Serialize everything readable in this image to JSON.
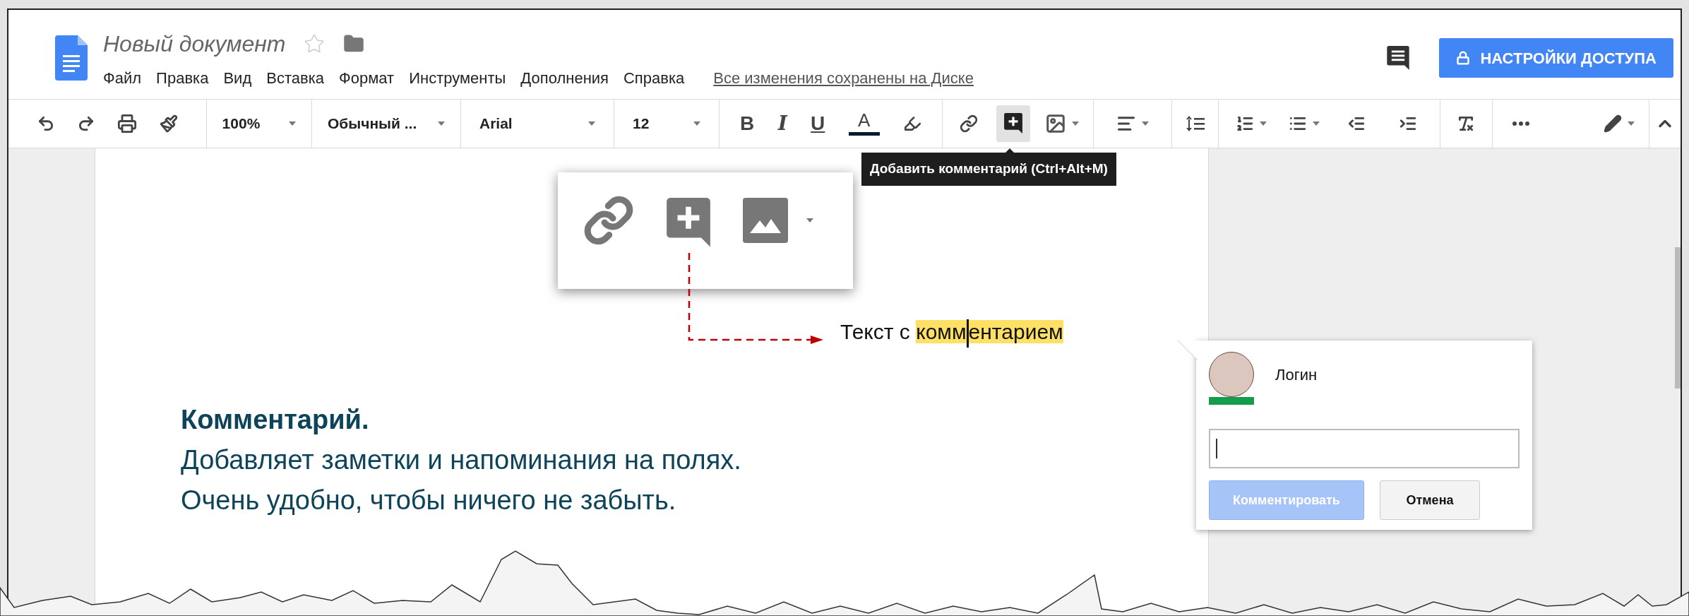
{
  "document": {
    "title": "Новый документ",
    "starred": false
  },
  "menu": [
    "Файл",
    "Правка",
    "Вид",
    "Вставка",
    "Формат",
    "Инструменты",
    "Дополнения",
    "Справка"
  ],
  "save_status": "Все изменения сохранены на Диске",
  "share_button": "НАСТРОЙКИ ДОСТУПА",
  "toolbar": {
    "zoom": "100%",
    "style": "Обычный ...",
    "font": "Arial",
    "size": "12",
    "format_letters": [
      "B",
      "I",
      "U"
    ],
    "text_color_letter": "A",
    "comment_button_selected": true
  },
  "tooltip": "Добавить комментарий (Ctrl+Alt+M)",
  "document_text": {
    "plain": "Текст с ",
    "highlighted_start": "комм",
    "highlighted_end": "ентарием"
  },
  "comment_card": {
    "author": "Логин",
    "submit": "Комментировать",
    "submit_disabled": true,
    "cancel": "Отмена"
  },
  "annotation": {
    "title": "Комментарий.",
    "lines": [
      "Добавляет заметки и напоминания на полях.",
      "Очень удобно, чтобы ничего не забыть."
    ]
  }
}
